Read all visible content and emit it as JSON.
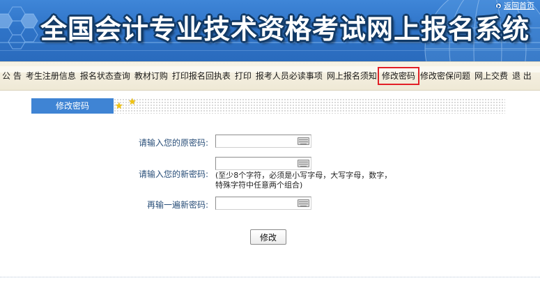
{
  "header": {
    "title": "全国会计专业技术资格考试网上报名系统",
    "home_link": "返回首页"
  },
  "nav": {
    "items": [
      {
        "label": "公 告",
        "active": false
      },
      {
        "label": "考生注册信息",
        "active": false
      },
      {
        "label": "报名状态查询",
        "active": false
      },
      {
        "label": "教材订购",
        "active": false
      },
      {
        "label": "打印报名回执表",
        "active": false
      },
      {
        "label": "打印",
        "active": false
      },
      {
        "label": "报考人员必读事项",
        "active": false
      },
      {
        "label": "网上报名须知",
        "active": false
      },
      {
        "label": "修改密码",
        "active": true
      },
      {
        "label": "修改密保问题",
        "active": false
      },
      {
        "label": "网上交费",
        "active": false
      },
      {
        "label": "退 出",
        "active": false
      }
    ]
  },
  "section": {
    "title": "修改密码"
  },
  "form": {
    "old_password_label": "请输入您的原密码:",
    "new_password_label": "请输入您的新密码:",
    "new_password_hint_line1": "(至少8个字符，必须是小写字母，大写字母，数字，",
    "new_password_hint_line2": "特殊字符中任意两个组合)",
    "confirm_password_label": "再输一遍新密码:",
    "old_password_value": "",
    "new_password_value": "",
    "confirm_password_value": "",
    "submit_label": "修改"
  },
  "colors": {
    "banner_blue": "#2f74c8",
    "section_tab_blue": "#3f84d4",
    "label_text": "#2a4f79",
    "active_nav_outline": "#e21f26"
  }
}
